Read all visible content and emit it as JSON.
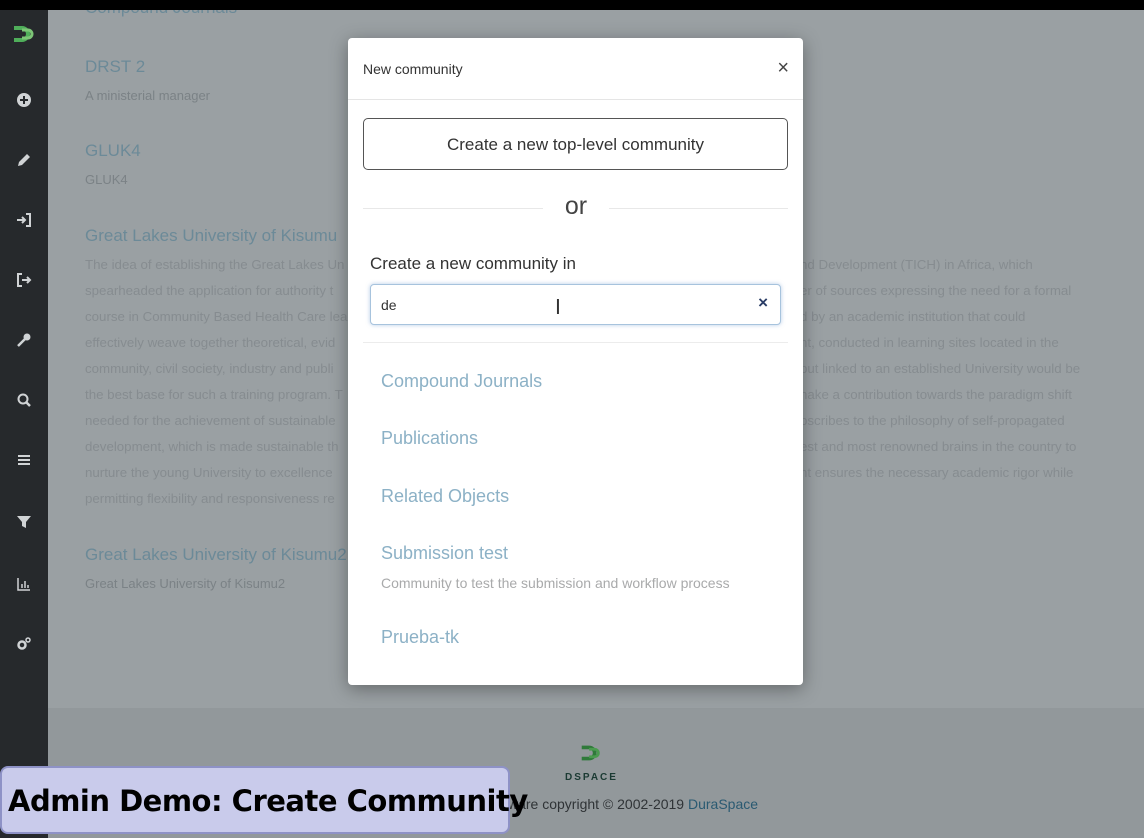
{
  "sidebar": {
    "logo": "dspace-logo-icon",
    "items": [
      {
        "icon": "plus-circle-icon"
      },
      {
        "icon": "pencil-icon"
      },
      {
        "icon": "import-icon"
      },
      {
        "icon": "export-icon"
      },
      {
        "icon": "key-icon"
      },
      {
        "icon": "search-icon"
      },
      {
        "icon": "list-icon"
      },
      {
        "icon": "filter-icon"
      },
      {
        "icon": "chart-icon"
      },
      {
        "icon": "gears-icon"
      }
    ]
  },
  "background": {
    "cut_title": "Compound Journals",
    "communities": [
      {
        "name": "DRST 2",
        "desc": "A ministerial manager"
      },
      {
        "name": "GLUK4",
        "desc": "GLUK4"
      },
      {
        "name": "Great Lakes University of Kisumu",
        "desc": ""
      },
      {
        "name": "Great Lakes University of Kisumu2",
        "desc": "Great Lakes University of Kisumu2"
      }
    ],
    "para_left": [
      "The idea of establishing the Great Lakes Un",
      "spearheaded the application for authority t",
      "course in Community Based Health Care lea",
      "effectively weave together theoretical, evid",
      "community, civil society, industry and publi",
      "the best base for such a training program. T",
      "needed for the achievement of sustainable",
      "development, which is made sustainable th",
      "nurture the young University to excellence",
      "permitting flexibility and responsiveness re"
    ],
    "para_right": [
      "nd Development (TICH) in Africa, which",
      "er of sources expressing the need for a formal",
      "d by an academic institution that could",
      "nt, conducted in learning sites located in the",
      "but linked to an established University would be",
      "nake a contribution towards the paradigm shift",
      "bscribes to the philosophy of self-propagated",
      "est and most renowned brains in the country to",
      "nt ensures the necessary academic rigor while",
      ""
    ]
  },
  "footer": {
    "logo_text": "DSPACE",
    "copyright_prefix": "ware copyright © 2002-2019 ",
    "copyright_brand": "DuraSpace"
  },
  "modal": {
    "title": "New community",
    "close": "×",
    "top_level_button": "Create a new top-level community",
    "or_text": "or",
    "in_label": "Create a new community in",
    "search": {
      "value": "de",
      "clear": "×"
    },
    "results": [
      {
        "name": "Compound Journals",
        "desc": ""
      },
      {
        "name": "Publications",
        "desc": ""
      },
      {
        "name": "Related Objects",
        "desc": ""
      },
      {
        "name": "Submission test",
        "desc": "Community to test the submission and workflow process"
      },
      {
        "name": "Prueba-tk",
        "desc": ""
      }
    ]
  },
  "caption": "Admin Demo: Create Community",
  "colors": {
    "sidebar": "#26292c",
    "overlay": "#9aa0a3",
    "link": "#8cb1c6",
    "caption_bg": "#c9cbeb"
  }
}
